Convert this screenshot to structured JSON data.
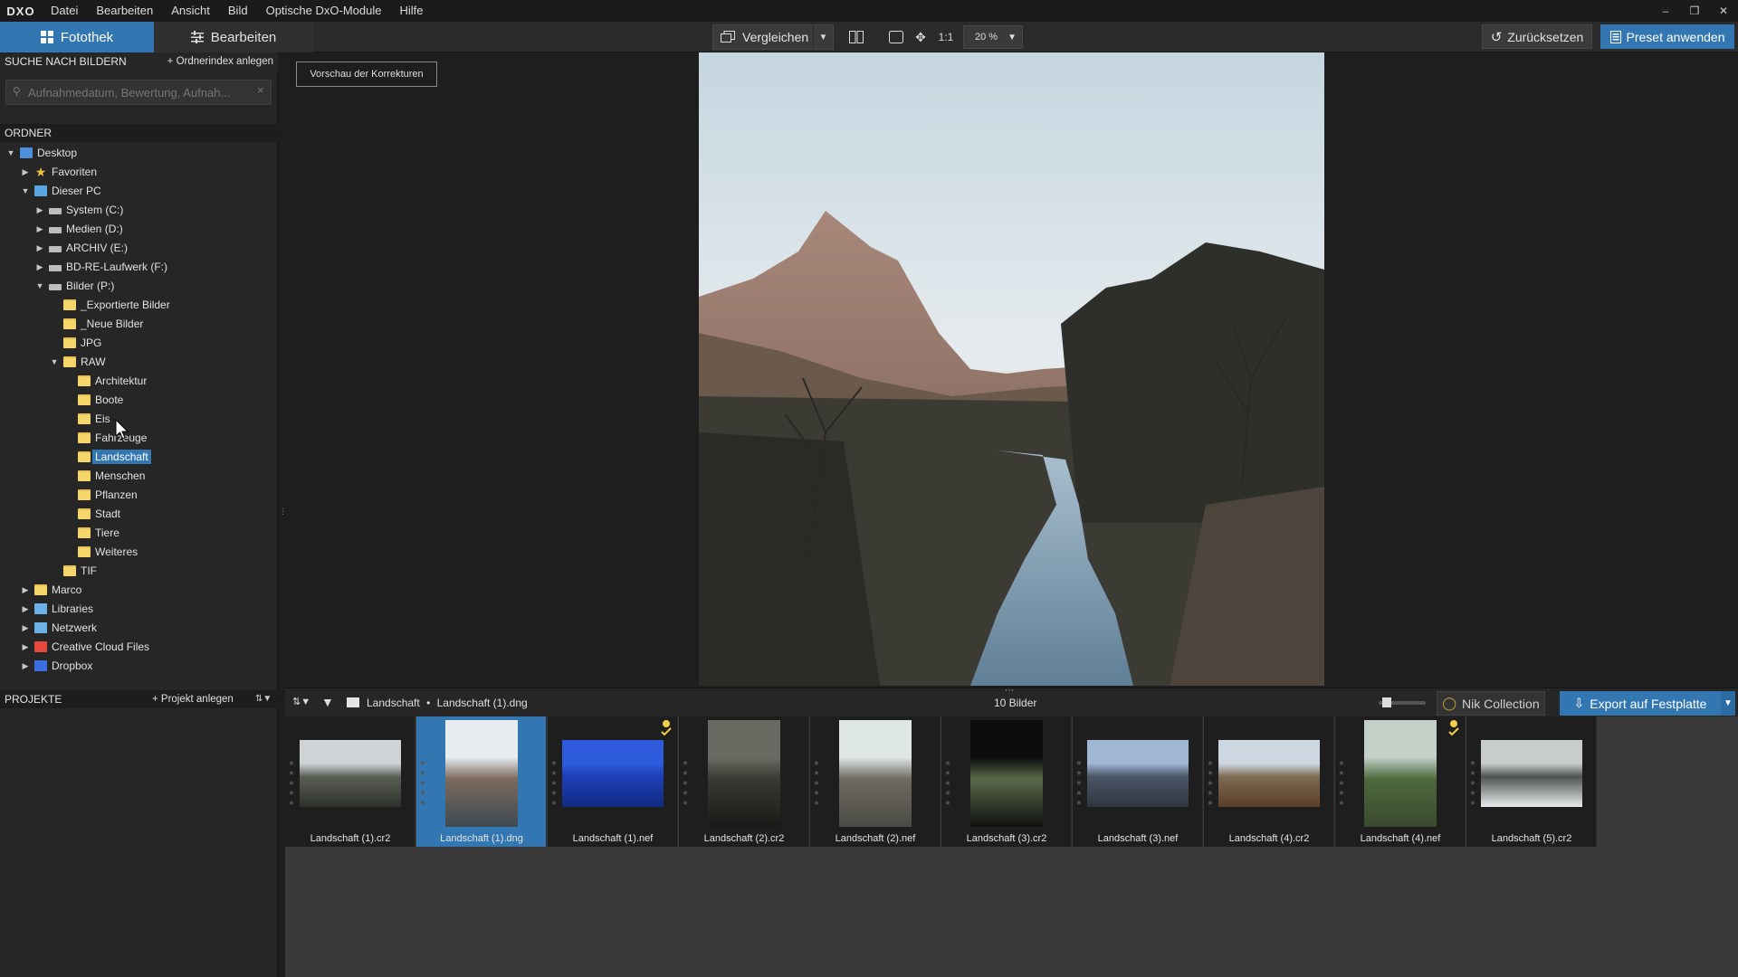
{
  "app": {
    "logo": "DXO"
  },
  "menu": [
    "Datei",
    "Bearbeiten",
    "Ansicht",
    "Bild",
    "Optische DxO-Module",
    "Hilfe"
  ],
  "toolbar": {
    "tab_library": "Fotothek",
    "tab_edit": "Bearbeiten",
    "compare": "Vergleichen",
    "one_to_one": "1:1",
    "zoom": "20 %",
    "reset": "Zurücksetzen",
    "apply_preset": "Preset anwenden"
  },
  "left": {
    "search_header": "SUCHE NACH BILDERN",
    "index_link": "+ Ordnerindex anlegen",
    "search_placeholder": "Aufnahmedatum, Bewertung, Aufnah...",
    "folders_header": "ORDNER",
    "tree": [
      {
        "label": "Desktop",
        "level": 0,
        "arrow": "down",
        "icon": "blue"
      },
      {
        "label": "Favoriten",
        "level": 1,
        "arrow": "right",
        "icon": "star"
      },
      {
        "label": "Dieser PC",
        "level": 1,
        "arrow": "down",
        "icon": "pc"
      },
      {
        "label": "System (C:)",
        "level": 2,
        "arrow": "right",
        "icon": "drive"
      },
      {
        "label": "Medien (D:)",
        "level": 2,
        "arrow": "right",
        "icon": "drive"
      },
      {
        "label": "ARCHIV (E:)",
        "level": 2,
        "arrow": "right",
        "icon": "drive"
      },
      {
        "label": "BD-RE-Laufwerk (F:)",
        "level": 2,
        "arrow": "right",
        "icon": "drive"
      },
      {
        "label": "Bilder (P:)",
        "level": 2,
        "arrow": "down",
        "icon": "drive"
      },
      {
        "label": "_Exportierte Bilder",
        "level": 3,
        "arrow": "",
        "icon": "folder"
      },
      {
        "label": "_Neue Bilder",
        "level": 3,
        "arrow": "",
        "icon": "folder"
      },
      {
        "label": "JPG",
        "level": 3,
        "arrow": "",
        "icon": "folder"
      },
      {
        "label": "RAW",
        "level": 3,
        "arrow": "down",
        "icon": "folder"
      },
      {
        "label": "Architektur",
        "level": 4,
        "arrow": "",
        "icon": "folder"
      },
      {
        "label": "Boote",
        "level": 4,
        "arrow": "",
        "icon": "folder"
      },
      {
        "label": "Eis",
        "level": 4,
        "arrow": "",
        "icon": "folder"
      },
      {
        "label": "Fahrzeuge",
        "level": 4,
        "arrow": "",
        "icon": "folder"
      },
      {
        "label": "Landschaft",
        "level": 4,
        "arrow": "",
        "icon": "folder",
        "selected": true
      },
      {
        "label": "Menschen",
        "level": 4,
        "arrow": "",
        "icon": "folder"
      },
      {
        "label": "Pflanzen",
        "level": 4,
        "arrow": "",
        "icon": "folder"
      },
      {
        "label": "Stadt",
        "level": 4,
        "arrow": "",
        "icon": "folder"
      },
      {
        "label": "Tiere",
        "level": 4,
        "arrow": "",
        "icon": "folder"
      },
      {
        "label": "Weiteres",
        "level": 4,
        "arrow": "",
        "icon": "folder"
      },
      {
        "label": "TIF",
        "level": 3,
        "arrow": "",
        "icon": "folder"
      },
      {
        "label": "Marco",
        "level": 1,
        "arrow": "right",
        "icon": "folder"
      },
      {
        "label": "Libraries",
        "level": 1,
        "arrow": "right",
        "icon": "net"
      },
      {
        "label": "Netzwerk",
        "level": 1,
        "arrow": "right",
        "icon": "net"
      },
      {
        "label": "Creative Cloud Files",
        "level": 1,
        "arrow": "right",
        "icon": "cc"
      },
      {
        "label": "Dropbox",
        "level": 1,
        "arrow": "right",
        "icon": "dropbox"
      }
    ],
    "projects_header": "PROJEKTE",
    "project_link": "+ Projekt anlegen"
  },
  "viewer": {
    "preview_button": "Vorschau der Korrekturen"
  },
  "filmstrip_bar": {
    "folder": "Landschaft",
    "separator": "•",
    "file": "Landschaft (1).dng",
    "count": "10 Bilder",
    "nik": "Nik Collection",
    "export": "Export auf Festplatte"
  },
  "thumbnails": [
    {
      "name": "Landschaft (1).cr2",
      "selected": false,
      "orient": "land",
      "badge": false,
      "colors": [
        "#cfd3d6",
        "#5a5f56",
        "#2e322a"
      ]
    },
    {
      "name": "Landschaft (1).dng",
      "selected": true,
      "orient": "port",
      "badge": false,
      "colors": [
        "#e6ecf0",
        "#7d6a5e",
        "#3f4a52"
      ]
    },
    {
      "name": "Landschaft (1).nef",
      "selected": false,
      "orient": "land",
      "badge": true,
      "colors": [
        "#2d5bdc",
        "#1f3fb8",
        "#102a80"
      ]
    },
    {
      "name": "Landschaft (2).cr2",
      "selected": false,
      "orient": "port",
      "badge": false,
      "colors": [
        "#6a6a62",
        "#3a3a34",
        "#1a1a18"
      ]
    },
    {
      "name": "Landschaft (2).nef",
      "selected": false,
      "orient": "port",
      "badge": false,
      "colors": [
        "#dfe6e6",
        "#6e6b60",
        "#4b4a44"
      ]
    },
    {
      "name": "Landschaft (3).cr2",
      "selected": false,
      "orient": "port",
      "badge": false,
      "colors": [
        "#0c0c0c",
        "#5b6a4a",
        "#101010"
      ]
    },
    {
      "name": "Landschaft (3).nef",
      "selected": false,
      "orient": "land",
      "badge": false,
      "colors": [
        "#9fb6d4",
        "#4a5566",
        "#2f3640"
      ]
    },
    {
      "name": "Landschaft (4).cr2",
      "selected": false,
      "orient": "land",
      "badge": false,
      "colors": [
        "#cdd7e2",
        "#7e6a52",
        "#5a3f2a"
      ]
    },
    {
      "name": "Landschaft (4).nef",
      "selected": false,
      "orient": "port",
      "badge": true,
      "colors": [
        "#c2d0c8",
        "#4d6a3c",
        "#3a4a30"
      ]
    },
    {
      "name": "Landschaft (5).cr2",
      "selected": false,
      "orient": "land",
      "badge": false,
      "colors": [
        "#c9cccc",
        "#4e5250",
        "#e8ecee"
      ]
    }
  ]
}
